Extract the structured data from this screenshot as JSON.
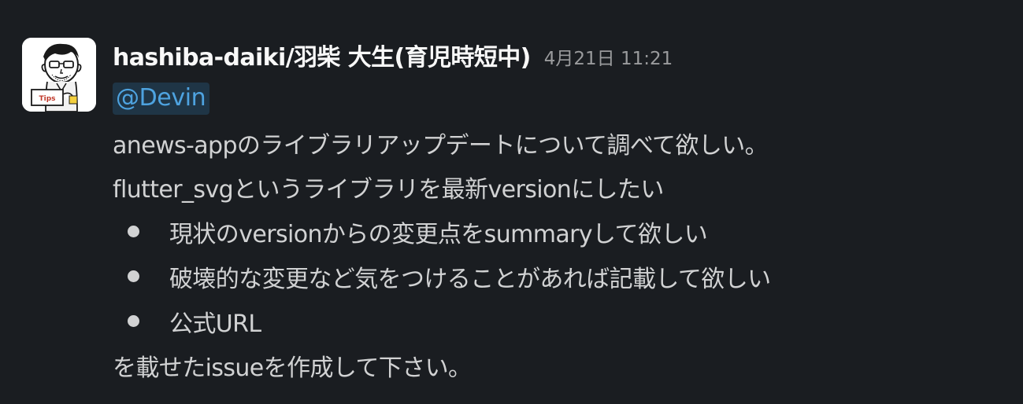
{
  "message": {
    "author": "hashiba-daiki/羽柴 大生(育児時短中)",
    "timestamp": "4月21日 11:21",
    "mention": "@Devin",
    "lines": [
      "anews-appのライブラリアップデートについて調べて欲しい。",
      "flutter_svgというライブラリを最新versionにしたい"
    ],
    "bullets": [
      "現状のversionからの変更点をsummaryして欲しい",
      "破壊的な変更など気をつけることがあれば記載して欲しい",
      "公式URL"
    ],
    "closing": "を載せたissueを作成して下さい。",
    "avatar_icon": "user-portrait-icon",
    "avatar_sign_text": "Tips"
  },
  "colors": {
    "background": "#1a1d21",
    "author": "#f8f8f8",
    "text": "#d1d2d3",
    "timestamp": "#9a9b9d",
    "mention_text": "#4ea3e0",
    "mention_bg": "#1f3546"
  }
}
